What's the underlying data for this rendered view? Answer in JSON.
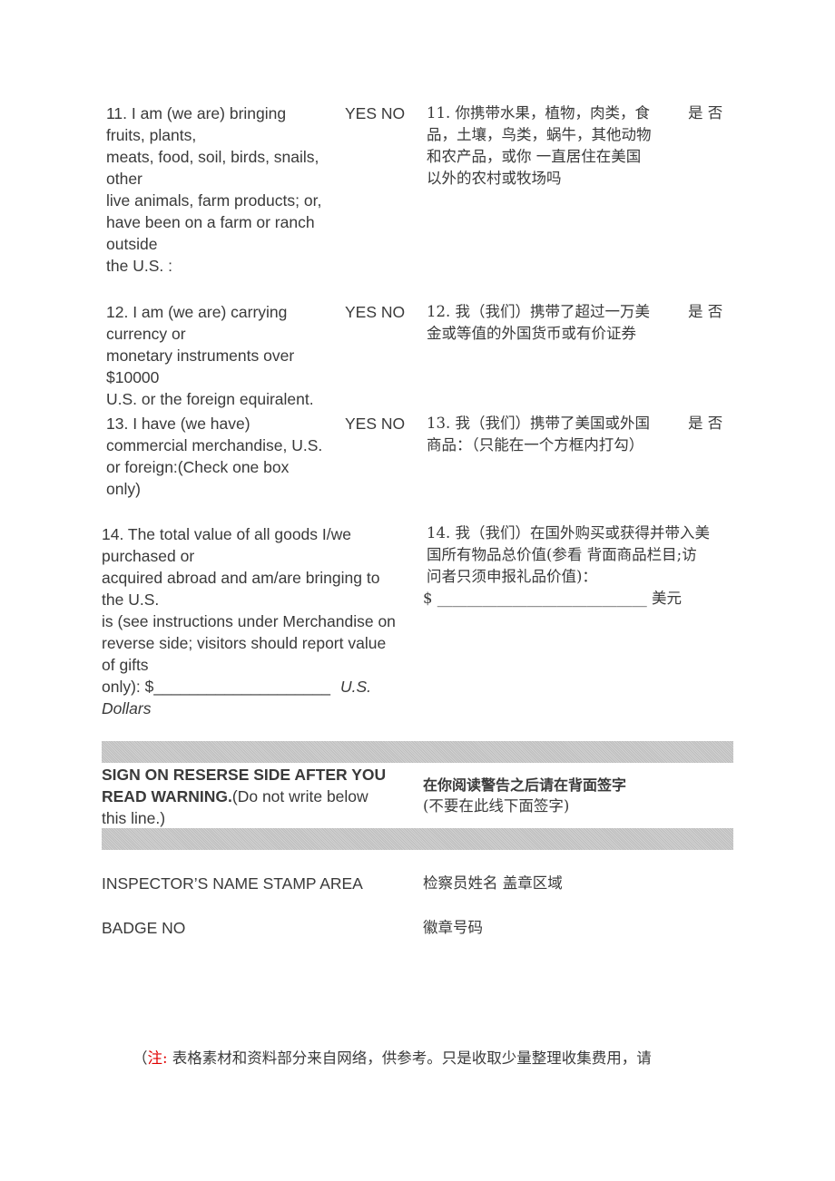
{
  "q11": {
    "en_lines": [
      "11. I am (we are) bringing",
      "fruits, plants,",
      "meats, food, soil, birds, snails,",
      "other",
      "live animals, farm products; or,",
      "have been on a farm or ranch",
      "outside",
      "the U.S. :"
    ],
    "yes_no": "YES NO",
    "zh_lines": [
      "11. 你携带水果，植物，肉类，食",
      "品，土壤，鸟类，蜗牛，其他动物",
      "和农产品，或你 一直居住在美国",
      "以外的农村或牧场吗"
    ],
    "zh_yes_no": "是 否"
  },
  "q12": {
    "en_lines": [
      "12. I am (we are) carrying",
      "currency or",
      "monetary instruments over",
      "$10000",
      "U.S. or the foreign equiralent."
    ],
    "yes_no": "YES NO",
    "zh_lines": [
      "12. 我（我们）携带了超过一万美",
      "金或等值的外国货币或有价证券"
    ],
    "zh_yes_no": "是 否"
  },
  "q13": {
    "en_lines": [
      "13. I have (we have)",
      "commercial merchandise, U.S.",
      "or foreign:(Check one box",
      "only)"
    ],
    "yes_no": "YES NO",
    "zh_lines": [
      "13. 我（我们）携带了美国或外国",
      "商品：（只能在一个方框内打勾）"
    ],
    "zh_yes_no": "是 否"
  },
  "q14": {
    "en_lines": [
      "14. The total value of all goods I/we",
      "purchased or",
      "acquired abroad and am/are bringing to",
      "the U.S.",
      "is (see instructions under Merchandise on",
      "reverse side; visitors should report value",
      "of gifts"
    ],
    "en_last": "only): $____________________",
    "en_unit_1": "U.S.",
    "en_unit_2": "Dollars",
    "zh_lines": [
      "14. 我（我们）在国外购买或获得并带入美",
      "国所有物品总价值(参看 背面商品栏目;访",
      "问者只须申报礼品价值)："
    ],
    "zh_amount": "$ ____________________________  美元"
  },
  "sign": {
    "en_bold_1": "SIGN ON RESERSE SIDE AFTER YOU",
    "en_bold_2": "READ WARNING.",
    "en_normal_2": "(Do not write below",
    "en_3": "this line.)",
    "zh_bold": "在你阅读警告之后请在背面签字",
    "zh_sub": "(不要在此线下面签字)"
  },
  "inspector": {
    "en": "INSPECTOR’S NAME STAMP AREA",
    "zh": "检察员姓名  盖章区域"
  },
  "badge": {
    "en": "BADGE NO",
    "zh": "徽章号码"
  },
  "note": {
    "open": "（",
    "label": "注:",
    "text": " 表格素材和资料部分来自网络，供参考。只是收取少量整理收集费用，请"
  },
  "colors": {
    "text": "#3a3a3a",
    "note_label": "#e00000",
    "band": "#c8c8c8"
  }
}
